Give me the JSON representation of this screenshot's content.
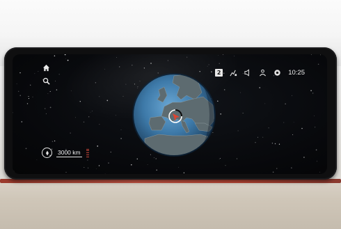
{
  "status_bar": {
    "profile_badge": "2",
    "time": "10:25",
    "icons": [
      "profile-badge-icon",
      "connectivity-icon",
      "volume-icon",
      "person-icon",
      "settings-icon"
    ]
  },
  "sidebar": {
    "buttons": [
      {
        "name": "home-icon"
      },
      {
        "name": "search-icon"
      }
    ]
  },
  "map": {
    "view": "globe",
    "scale_label": "3000 km"
  },
  "colors": {
    "screen_bg": "#07080b",
    "globe_ocean": "#3d79a8",
    "land": "#5d6b70",
    "position_marker": "#e0432f",
    "trim_accent": "#c44a37"
  }
}
